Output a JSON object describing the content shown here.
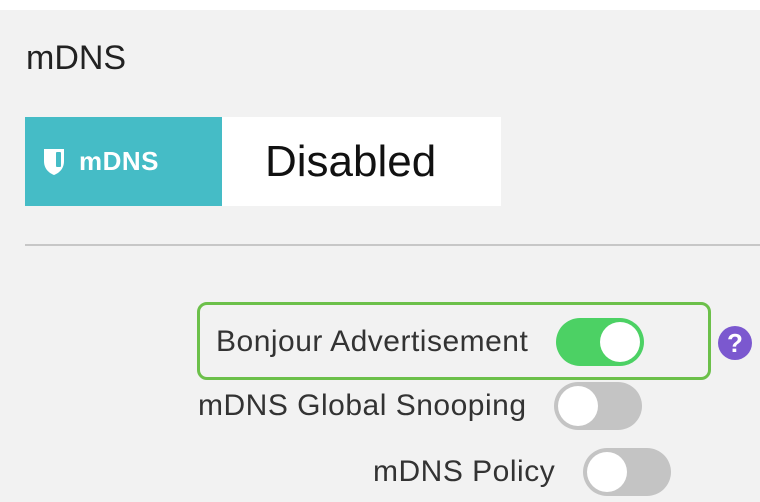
{
  "section": {
    "title": "mDNS"
  },
  "status_card": {
    "tag_icon": "shield-icon",
    "tag_label": "mDNS",
    "value": "Disabled"
  },
  "settings": {
    "bonjour": {
      "label": "Bonjour Advertisement",
      "enabled": true
    },
    "global_snooping": {
      "label": "mDNS Global Snooping",
      "enabled": false
    },
    "policy": {
      "label": "mDNS Policy",
      "enabled": false
    }
  },
  "help": {
    "icon": "help-icon",
    "glyph": "?"
  },
  "colors": {
    "accent_teal": "#45bcc6",
    "toggle_on": "#4cd164",
    "toggle_off": "#c4c4c4",
    "highlight_border": "#6cc04a",
    "help_purple": "#7b58cf"
  }
}
